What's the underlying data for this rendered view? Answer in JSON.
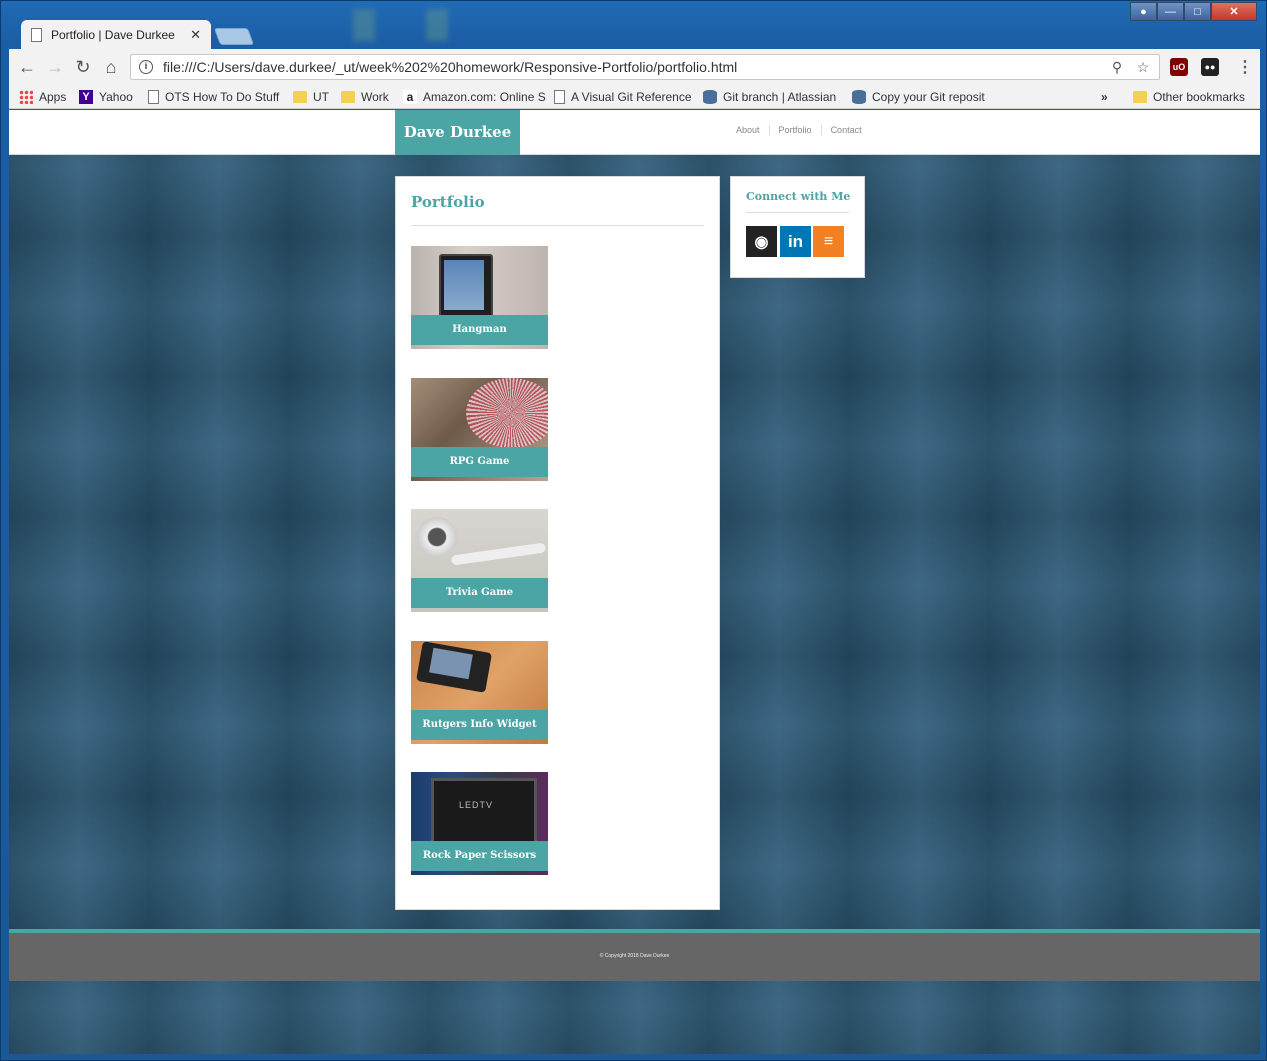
{
  "browser": {
    "tab_title": "Portfolio | Dave Durkee",
    "tab_close": "✕",
    "url": "file:///C:/Users/dave.durkee/_ut/week%202%20homework/Responsive-Portfolio/portfolio.html",
    "bookmarks": [
      {
        "label": "Apps",
        "icon": "apps-icon"
      },
      {
        "label": "Yahoo",
        "icon": "yahoo-icon"
      },
      {
        "label": "OTS How To Do Stuff",
        "icon": "page-icon"
      },
      {
        "label": "UT",
        "icon": "folder-icon"
      },
      {
        "label": "Work",
        "icon": "folder-icon"
      },
      {
        "label": "Amazon.com: Online S",
        "icon": "amazon-icon"
      },
      {
        "label": "A Visual Git Reference",
        "icon": "page-icon"
      },
      {
        "label": "Git branch | Atlassian",
        "icon": "database-icon"
      },
      {
        "label": "Copy your Git reposit",
        "icon": "database-icon"
      }
    ],
    "overflow": "»",
    "other_bookmarks": "Other bookmarks"
  },
  "site": {
    "brand": "Dave Durkee",
    "nav": [
      "About",
      "Portfolio",
      "Contact"
    ],
    "section_title": "Portfolio",
    "projects": [
      "Hangman",
      "RPG Game",
      "Trivia Game",
      "Rutgers Info Widget",
      "Rock Paper Scissors"
    ],
    "connect_title": "Connect with Me",
    "social": [
      "github-icon",
      "linkedin-icon",
      "stackoverflow-icon"
    ],
    "copyright": "© Copyright 2018 Dave Durkee"
  },
  "colors": {
    "accent": "#4ba5a4",
    "footer": "#666666",
    "background": "#2c5a77"
  }
}
